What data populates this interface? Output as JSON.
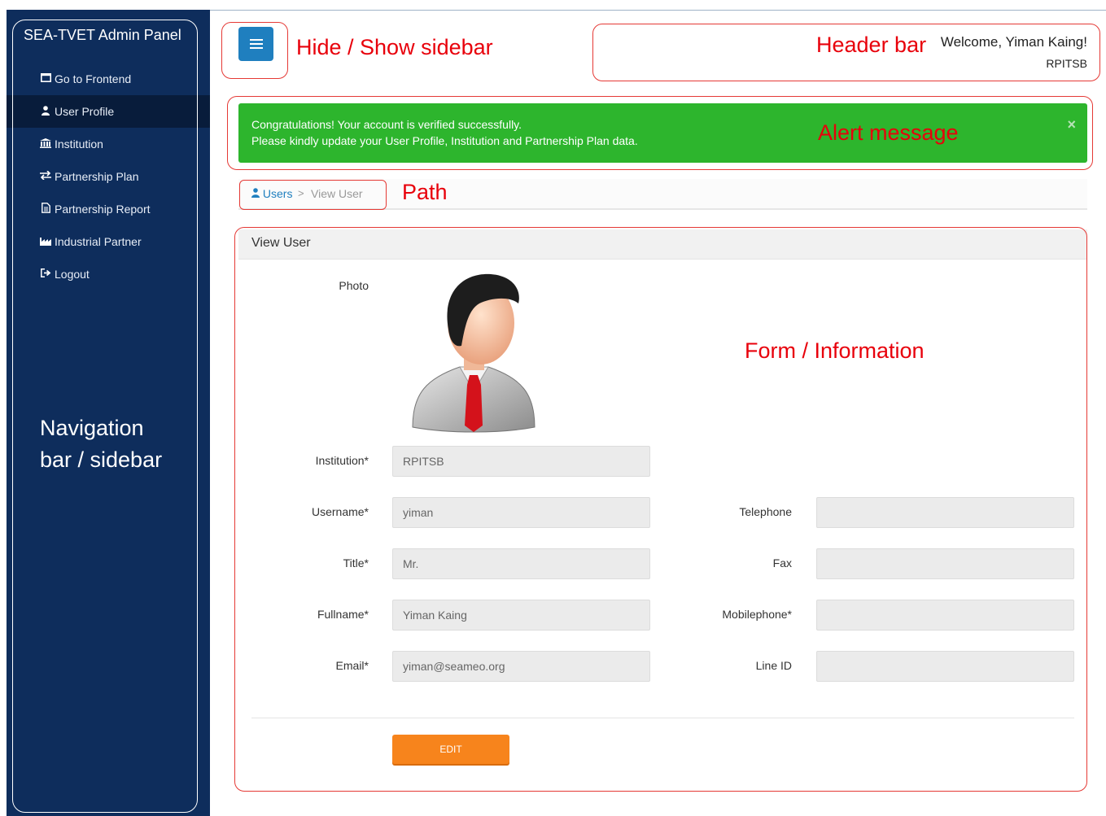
{
  "sidebar": {
    "brand": "SEA-TVET Admin Panel",
    "items": [
      {
        "icon": "window-icon",
        "label": "Go to Frontend",
        "active": false
      },
      {
        "icon": "user-icon",
        "label": "User Profile",
        "active": true
      },
      {
        "icon": "bank-icon",
        "label": "Institution",
        "active": false
      },
      {
        "icon": "exchange-icon",
        "label": "Partnership Plan",
        "active": false
      },
      {
        "icon": "document-icon",
        "label": "Partnership Report",
        "active": false
      },
      {
        "icon": "industry-icon",
        "label": "Industrial Partner",
        "active": false
      },
      {
        "icon": "logout-icon",
        "label": "Logout",
        "active": false
      }
    ]
  },
  "annotations": {
    "toggle": "Hide / Show sidebar",
    "header": "Header bar",
    "alert": "Alert message",
    "path": "Path",
    "form": "Form / Information",
    "nav_line1": "Navigation",
    "nav_line2": "bar / sidebar"
  },
  "header": {
    "welcome": "Welcome, Yiman Kaing!",
    "institution": "RPITSB"
  },
  "alert": {
    "line1": "Congratulations! Your account is verified successfully.",
    "line2": "Please kindly update your User Profile, Institution and Partnership Plan data.",
    "close": "×"
  },
  "breadcrumb": {
    "parent": "Users",
    "separator": ">",
    "current": "View User"
  },
  "panel": {
    "title": "View User",
    "photo_label": "Photo"
  },
  "form": {
    "institution": {
      "label": "Institution*",
      "value": "RPITSB"
    },
    "username": {
      "label": "Username*",
      "value": "yiman"
    },
    "title": {
      "label": "Title*",
      "value": "Mr."
    },
    "fullname": {
      "label": "Fullname*",
      "value": "Yiman Kaing"
    },
    "email": {
      "label": "Email*",
      "value": "yiman@seameo.org"
    },
    "telephone": {
      "label": "Telephone",
      "value": ""
    },
    "fax": {
      "label": "Fax",
      "value": ""
    },
    "mobilephone": {
      "label": "Mobilephone*",
      "value": ""
    },
    "line_id": {
      "label": "Line ID",
      "value": ""
    }
  },
  "actions": {
    "edit_label": "EDIT"
  },
  "colors": {
    "sidebar": "#0e2d5c",
    "alert_success": "#2db52d",
    "edit_button": "#f7841c",
    "toggle_button": "#1f7fbf",
    "annotation": "#e8000b"
  }
}
